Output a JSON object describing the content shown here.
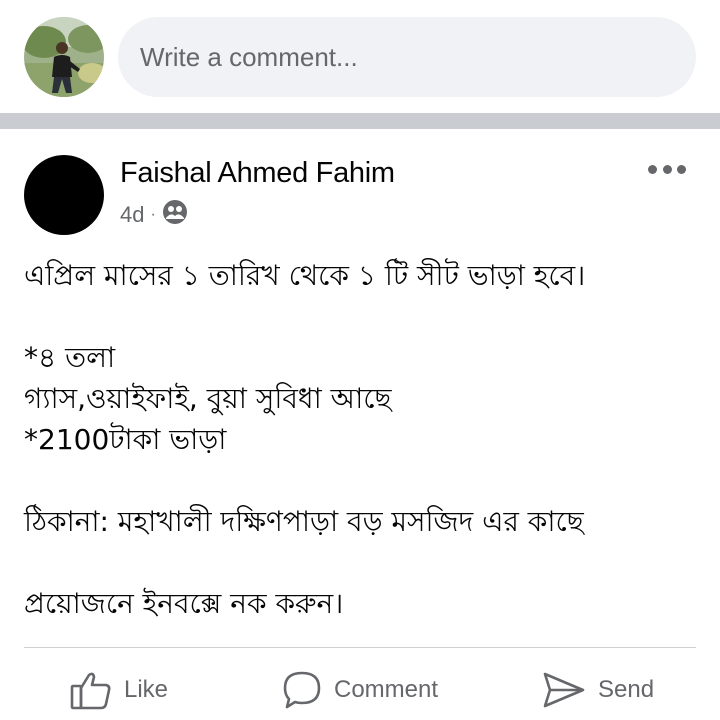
{
  "comment_bar": {
    "placeholder": "Write a comment..."
  },
  "post": {
    "author": "Faishal Ahmed Fahim",
    "time": "4d",
    "separator": "·",
    "privacy_icon": "friends-icon",
    "lines": [
      "এপ্রিল মাসের ১ তারিখ থেকে ১ টি সীট ভাড়া হবে।",
      "",
      "*৪ তলা",
      "গ্যাস,ওয়াইফাই, বুয়া সুবিধা আছে",
      "*2100টাকা ভাড়া",
      "",
      "ঠিকানা: মহাখালী দক্ষিণপাড়া বড় মসজিদ এর কাছে",
      "",
      "প্রয়োজনে ইনবক্সে নক করুন।"
    ]
  },
  "actions": {
    "like": "Like",
    "comment": "Comment",
    "send": "Send"
  },
  "colors": {
    "secondary_text": "#65676b",
    "input_bg": "#f0f2f5",
    "separator": "#c9ccd1"
  }
}
